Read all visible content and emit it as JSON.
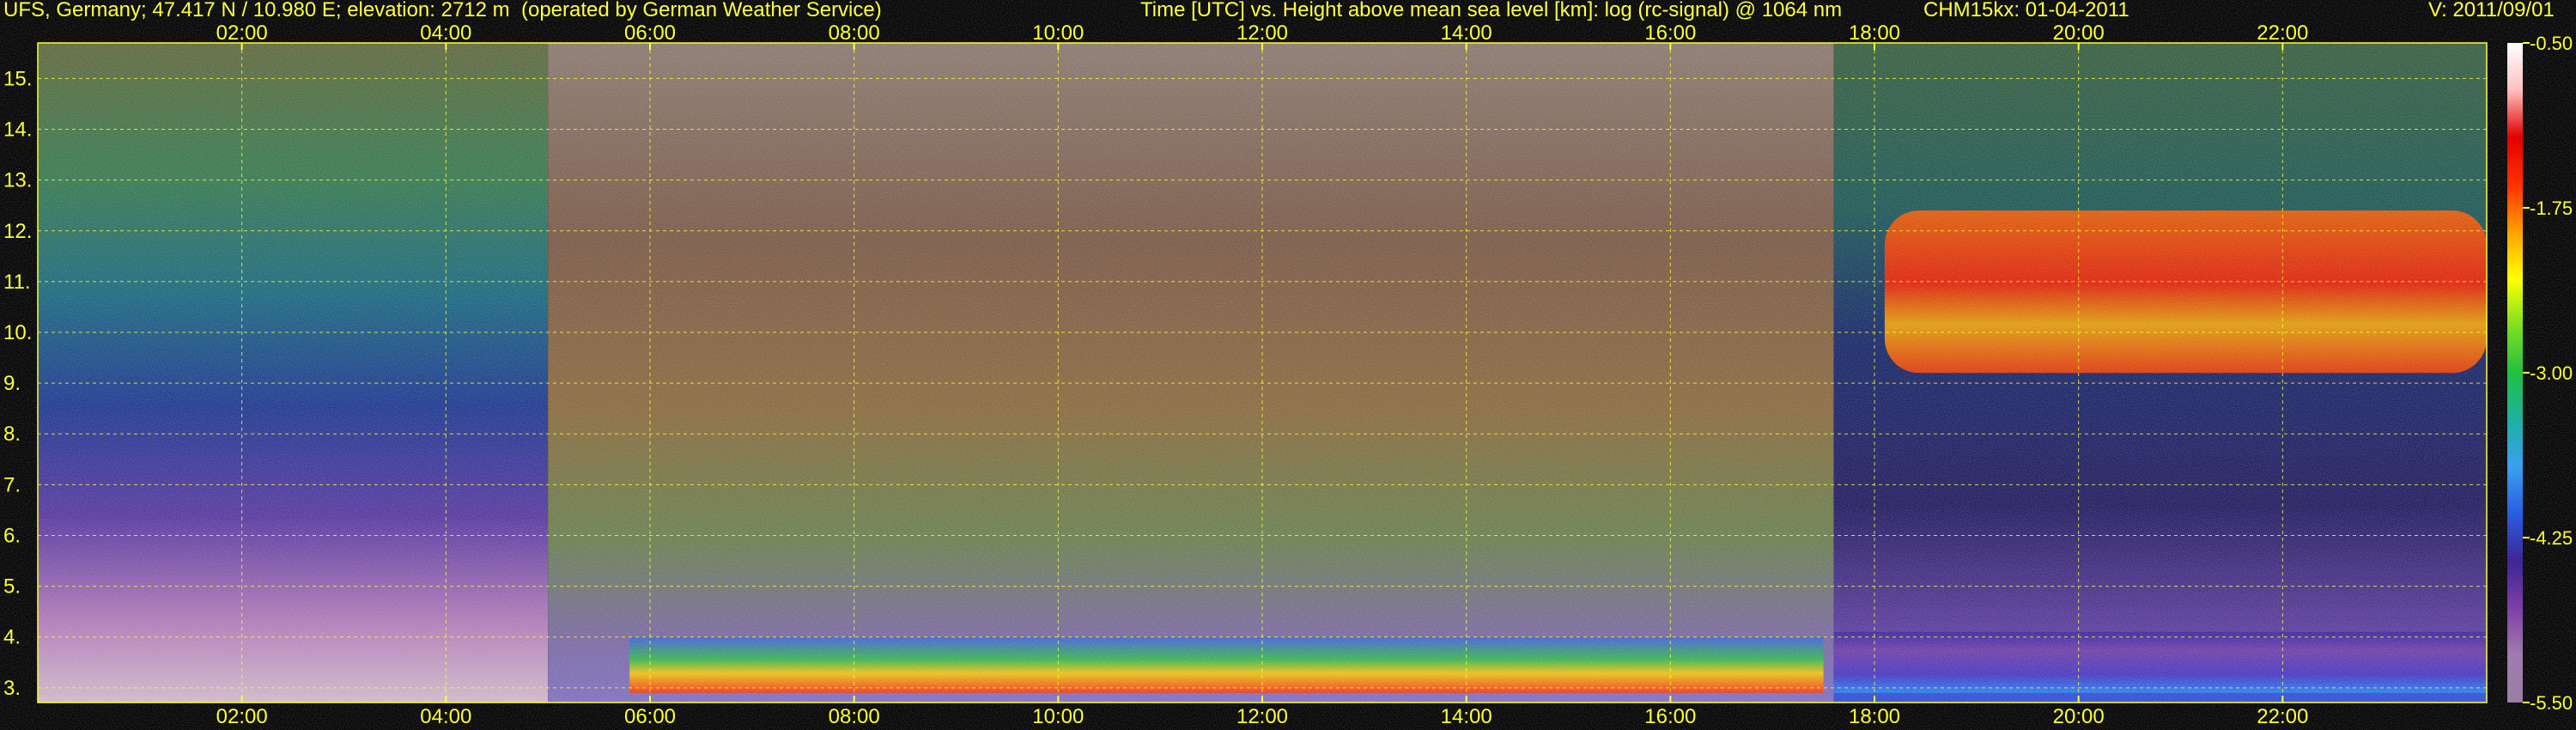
{
  "header": {
    "station": "UFS, Germany; 47.417 N / 10.980 E; elevation: 2712 m  (operated by German Weather Service)",
    "plot_title": "Time [UTC] vs. Height above mean sea level [km]: log (rc-signal) @ 1064 nm",
    "instrument": "CHM15kx: 01-04-2011",
    "version": "V: 2011/09/01"
  },
  "chart_data": {
    "type": "heatmap",
    "title": "Time [UTC] vs. Height above mean sea level [km]: log (rc-signal) @ 1064 nm",
    "x_ticks": [
      "02:00",
      "04:00",
      "06:00",
      "08:00",
      "10:00",
      "12:00",
      "14:00",
      "16:00",
      "18:00",
      "20:00",
      "22:00"
    ],
    "x_tick_hours": [
      2,
      4,
      6,
      8,
      10,
      12,
      14,
      16,
      18,
      20,
      22
    ],
    "xlim_hours": [
      0,
      24
    ],
    "y_ticks": [
      "3.",
      "4.",
      "5.",
      "6.",
      "7.",
      "8.",
      "9.",
      "10.",
      "11.",
      "12.",
      "13.",
      "14.",
      "15."
    ],
    "y_tick_values": [
      3,
      4,
      5,
      6,
      7,
      8,
      9,
      10,
      11,
      12,
      13,
      14,
      15
    ],
    "ylim": [
      2.71,
      15.7
    ],
    "grid": true,
    "colorbar": {
      "ticks": [
        "-0.50",
        "-1.75",
        "-3.00",
        "-4.25",
        "-5.50"
      ],
      "tick_values": [
        -0.5,
        -1.75,
        -3.0,
        -4.25,
        -5.5
      ],
      "range": [
        -5.5,
        -0.5
      ],
      "colors": [
        "#9a7ea4",
        "#a07cae",
        "#7e3fa6",
        "#3c2696",
        "#2a5ce0",
        "#3aa0f0",
        "#1fb0a0",
        "#20c040",
        "#80e020",
        "#ffff00",
        "#ffa000",
        "#ff3000",
        "#e00000",
        "#ffc0c0",
        "#ffffff"
      ]
    },
    "regions": [
      {
        "name": "night-background",
        "x_start": 0,
        "x_end": 5.0,
        "y_start": 2.71,
        "y_end": 15.7
      },
      {
        "name": "day-background",
        "x_start": 5.0,
        "x_end": 17.6,
        "y_start": 2.71,
        "y_end": 15.7
      },
      {
        "name": "night-background-2",
        "x_start": 17.6,
        "x_end": 24,
        "y_start": 2.71,
        "y_end": 15.7
      },
      {
        "name": "boundary-layer-cloud",
        "x_start": 5.8,
        "x_end": 17.5,
        "y_start": 2.9,
        "y_end": 4.0
      },
      {
        "name": "cirrus-cloud",
        "x_start": 18.1,
        "x_end": 24,
        "y_start": 9.2,
        "y_end": 12.4
      },
      {
        "name": "surface-aerosol-layer",
        "x_start": 17.6,
        "x_end": 24,
        "y_start": 2.9,
        "y_end": 4.1
      }
    ]
  }
}
